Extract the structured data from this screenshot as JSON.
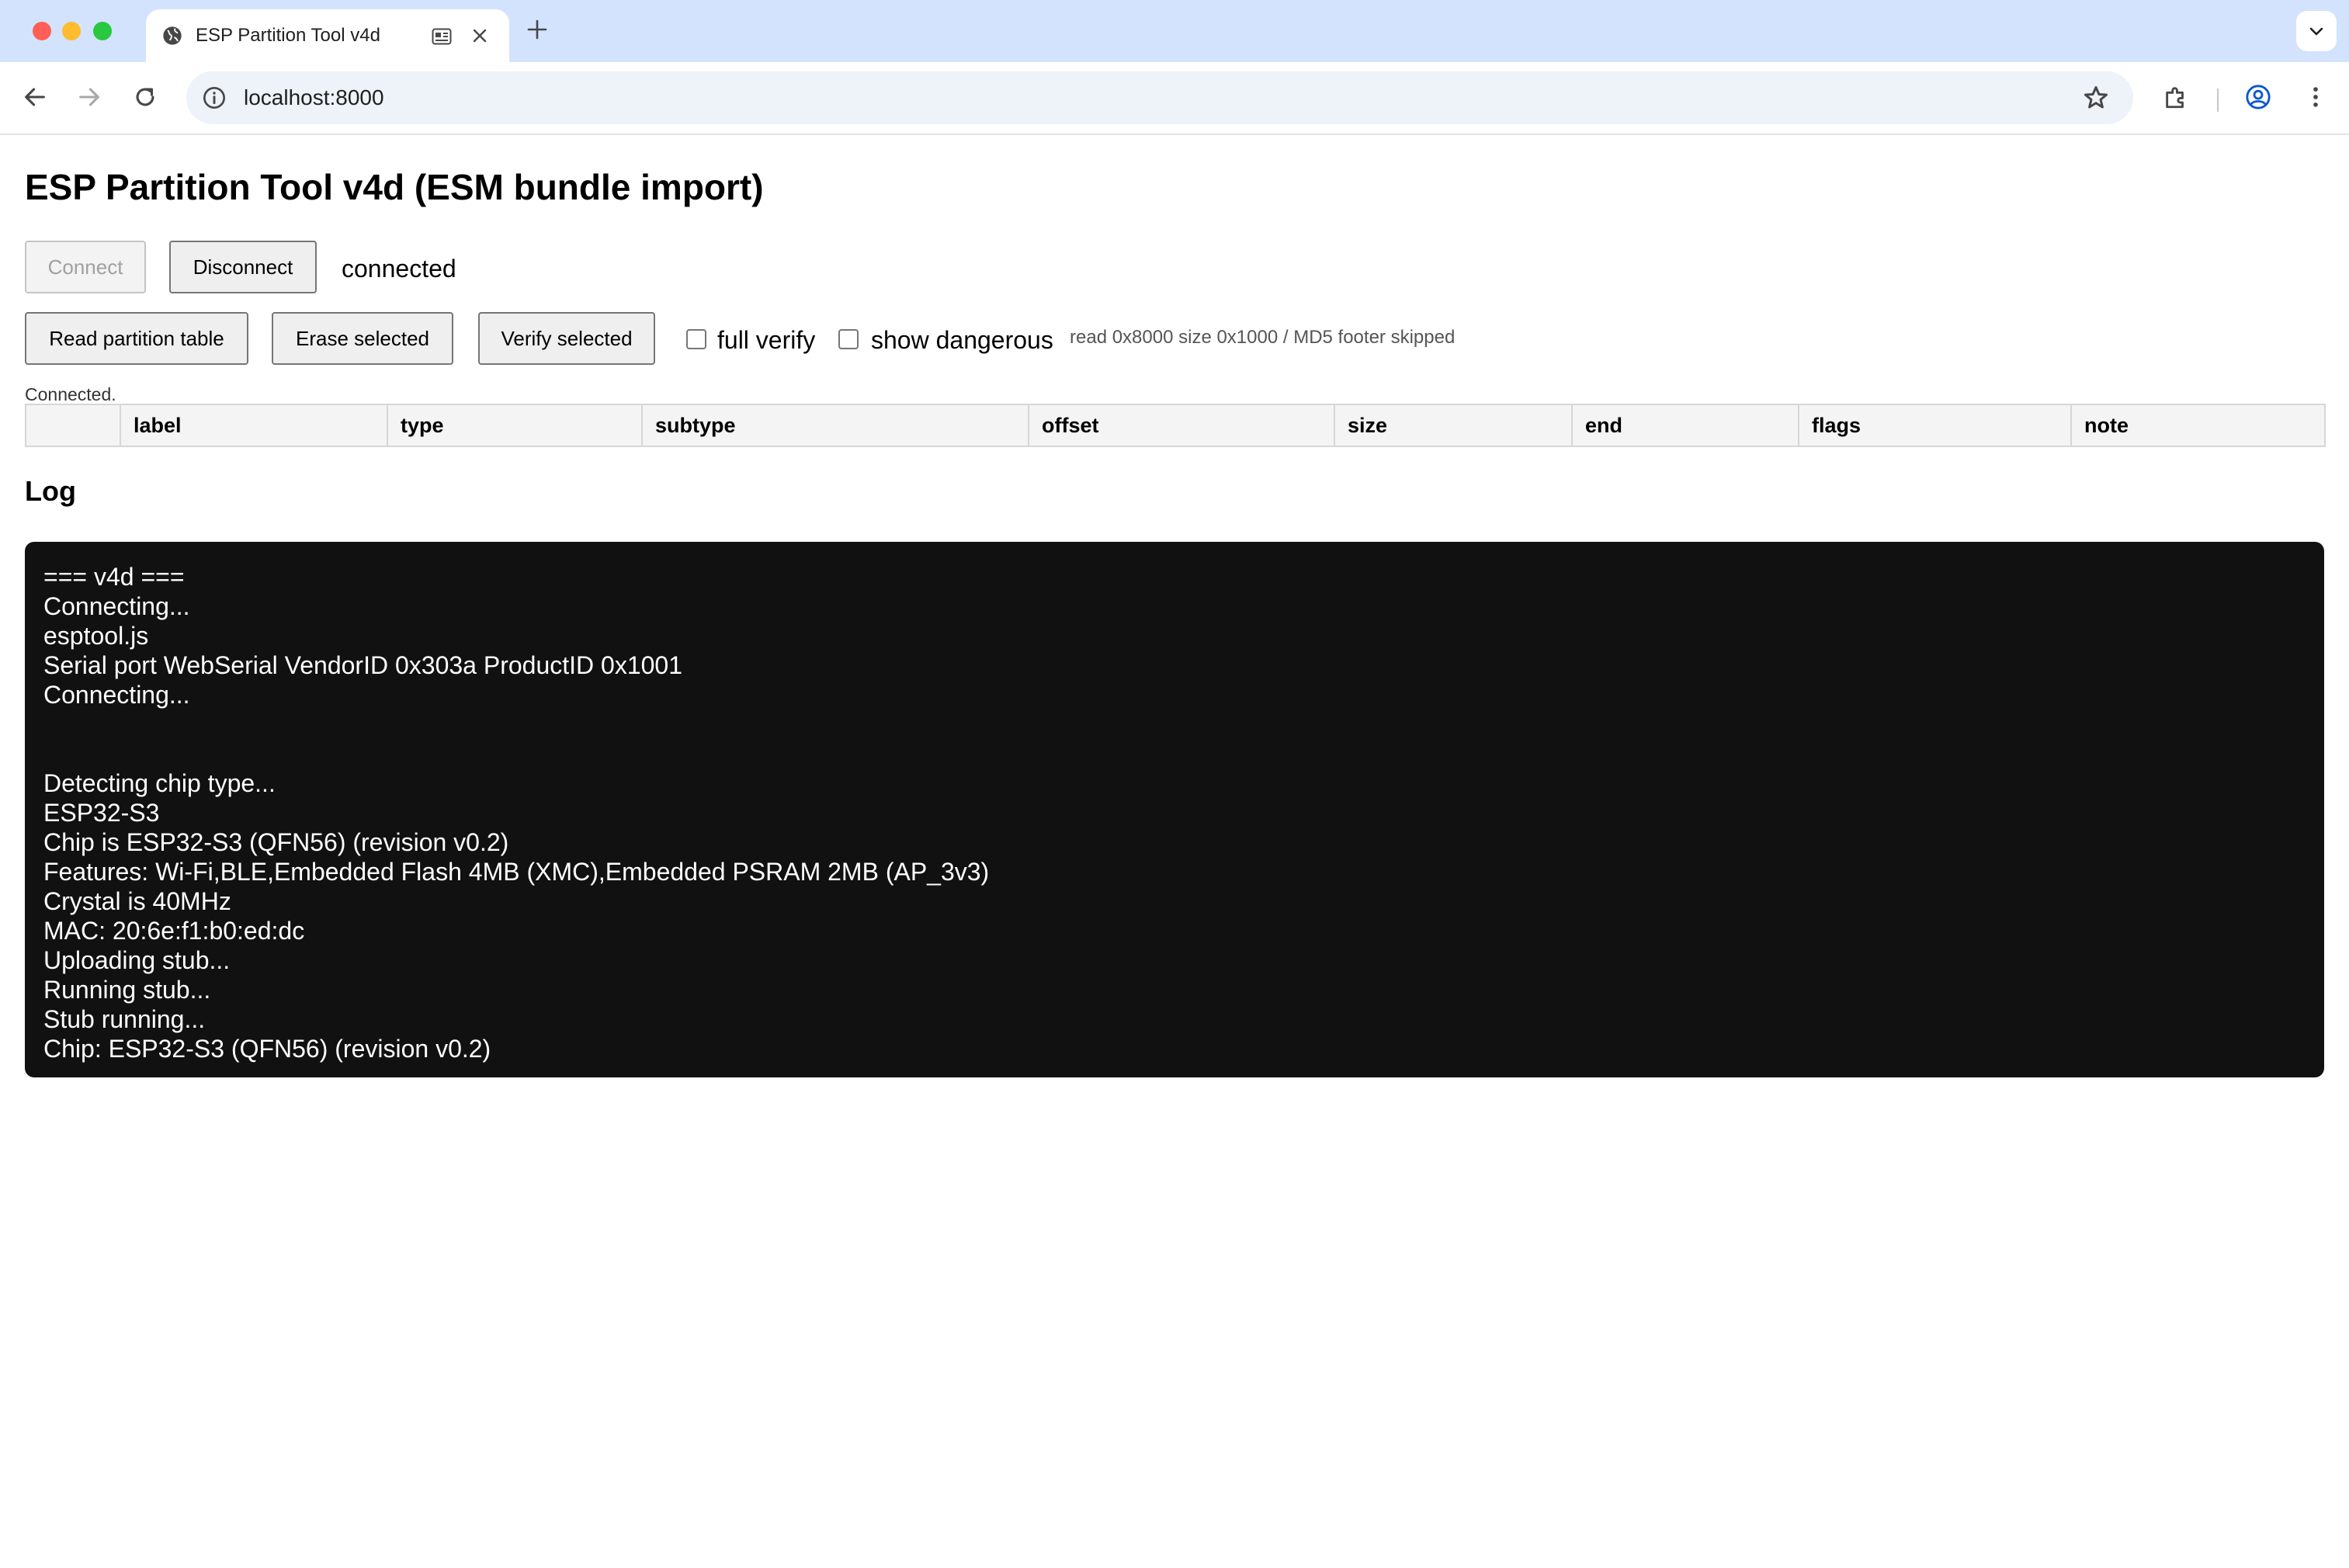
{
  "browser": {
    "tab_title": "ESP Partition Tool v4d",
    "url": "localhost:8000"
  },
  "page": {
    "title": "ESP Partition Tool v4d (ESM bundle import)",
    "buttons": {
      "connect": "Connect",
      "disconnect": "Disconnect",
      "read_partition_table": "Read partition table",
      "erase_selected": "Erase selected",
      "verify_selected": "Verify selected"
    },
    "status": "connected",
    "options": {
      "full_verify": "full verify",
      "show_dangerous": "show dangerous"
    },
    "info": "read 0x8000 size 0x1000 / MD5 footer skipped",
    "connected_note": "Connected.",
    "table": {
      "columns": [
        "",
        "label",
        "type",
        "subtype",
        "offset",
        "size",
        "end",
        "flags",
        "note"
      ]
    },
    "log": {
      "title": "Log",
      "lines": [
        "=== v4d ===",
        "Connecting...",
        "esptool.js",
        "Serial port WebSerial VendorID 0x303a ProductID 0x1001",
        "Connecting...",
        "",
        "",
        "Detecting chip type...",
        "ESP32-S3",
        "Chip is ESP32-S3 (QFN56) (revision v0.2)",
        "Features: Wi-Fi,BLE,Embedded Flash 4MB (XMC),Embedded PSRAM 2MB (AP_3v3)",
        "Crystal is 40MHz",
        "MAC: 20:6e:f1:b0:ed:dc",
        "Uploading stub...",
        "Running stub...",
        "Stub running...",
        "Chip: ESP32-S3 (QFN56) (revision v0.2)"
      ]
    }
  }
}
